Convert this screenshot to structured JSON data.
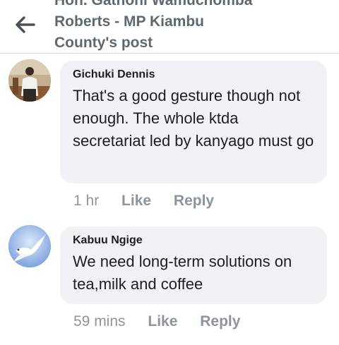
{
  "header": {
    "back_icon": "arrow-left-icon",
    "title_lines": [
      "Hon. Gathoni Wamuchomba",
      "Roberts - MP Kiambu",
      "County's post"
    ]
  },
  "comments": [
    {
      "author": "Gichuki Dennis",
      "text": "That's a good gesture though not enough. The whole ktda secretariat led by kanyago must go",
      "time": "1 hr",
      "like": "Like",
      "reply": "Reply",
      "avatar": "person-photo"
    },
    {
      "author": "Kabuu Ngige",
      "text": "We need long-term solutions on tea,milk and coffee",
      "time": "59 mins",
      "like": "Like",
      "reply": "Reply",
      "avatar": "dove-icon"
    }
  ]
}
